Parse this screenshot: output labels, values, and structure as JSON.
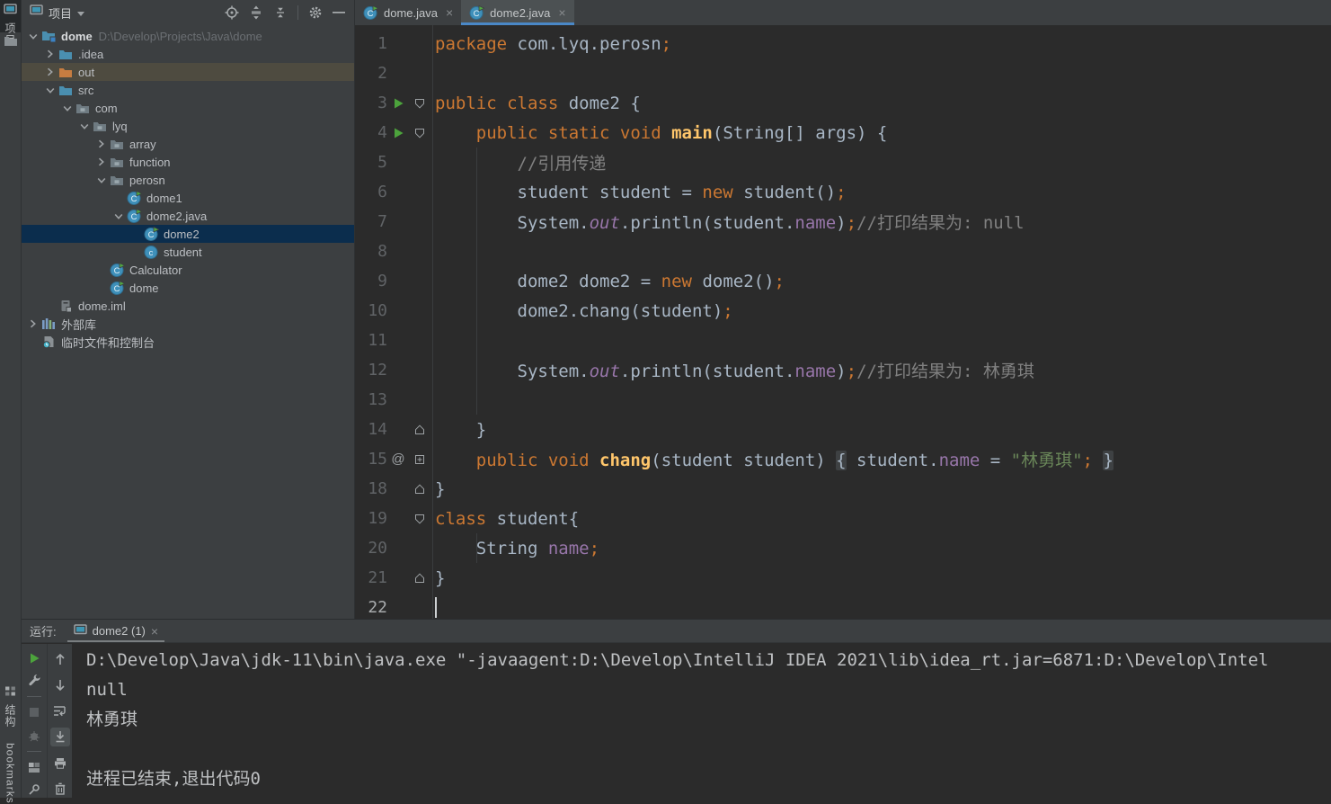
{
  "stripe": {
    "project_tab": "项目",
    "structure_tab": "结构",
    "bookmarks_tab": "bookmarks"
  },
  "project": {
    "title": "项目",
    "header_icons": [
      "locate",
      "expand-all",
      "collapse-all",
      "divider",
      "settings",
      "hide"
    ],
    "tree": [
      {
        "label": "dome",
        "path": "D:\\Develop\\Projects\\Java\\dome",
        "level": 0,
        "chevron": "down",
        "icon": "folder-root",
        "bold": true
      },
      {
        "label": ".idea",
        "level": 1,
        "chevron": "right",
        "icon": "folder"
      },
      {
        "label": "out",
        "level": 1,
        "chevron": "right",
        "icon": "folder-out",
        "state": "hover"
      },
      {
        "label": "src",
        "level": 1,
        "chevron": "down",
        "icon": "folder"
      },
      {
        "label": "com",
        "level": 2,
        "chevron": "down",
        "icon": "package"
      },
      {
        "label": "lyq",
        "level": 3,
        "chevron": "down",
        "icon": "package"
      },
      {
        "label": "array",
        "level": 4,
        "chevron": "right",
        "icon": "package"
      },
      {
        "label": "function",
        "level": 4,
        "chevron": "right",
        "icon": "package"
      },
      {
        "label": "perosn",
        "level": 4,
        "chevron": "down",
        "icon": "package"
      },
      {
        "label": "dome1",
        "level": 5,
        "icon": "class-run"
      },
      {
        "label": "dome2.java",
        "level": 5,
        "chevron": "down",
        "icon": "class-run"
      },
      {
        "label": "dome2",
        "level": 6,
        "icon": "class-run",
        "state": "selected"
      },
      {
        "label": "student",
        "level": 6,
        "icon": "class"
      },
      {
        "label": "Calculator",
        "level": 4,
        "icon": "class-run"
      },
      {
        "label": "dome",
        "level": 4,
        "icon": "class-run"
      },
      {
        "label": "dome.iml",
        "level": 1,
        "icon": "module"
      },
      {
        "label": "外部库",
        "level": 0,
        "chevron": "right",
        "icon": "libraries"
      },
      {
        "label": "临时文件和控制台",
        "level": 0,
        "icon": "scratches"
      }
    ]
  },
  "editor": {
    "tabs": [
      {
        "label": "dome.java",
        "active": false
      },
      {
        "label": "dome2.java",
        "active": true
      }
    ],
    "lines": [
      {
        "no": "1",
        "segs": [
          [
            "package",
            "kw"
          ],
          [
            " com.lyq.perosn",
            "pl"
          ],
          [
            ";",
            "semi"
          ]
        ]
      },
      {
        "no": "2",
        "segs": []
      },
      {
        "no": "3",
        "run": true,
        "fold": "open",
        "segs": [
          [
            "public class ",
            "kw"
          ],
          [
            "dome2 {",
            "pl"
          ]
        ]
      },
      {
        "no": "4",
        "run": true,
        "fold": "open",
        "segs": [
          [
            "    ",
            "pl"
          ],
          [
            "public static void ",
            "kw"
          ],
          [
            "main",
            "def"
          ],
          [
            "(String[] args) {",
            "pl"
          ]
        ]
      },
      {
        "no": "5",
        "segs": [
          [
            "        ",
            "pl"
          ],
          [
            "//引用传递",
            "cmt"
          ]
        ]
      },
      {
        "no": "6",
        "segs": [
          [
            "        student student = ",
            "pl"
          ],
          [
            "new",
            "kw"
          ],
          [
            " student()",
            "pl"
          ],
          [
            ";",
            "semi"
          ]
        ]
      },
      {
        "no": "7",
        "segs": [
          [
            "        System.",
            "pl"
          ],
          [
            "out",
            "fieldi"
          ],
          [
            ".println(student.",
            "pl"
          ],
          [
            "name",
            "field"
          ],
          [
            ")",
            "pl"
          ],
          [
            ";",
            "semi"
          ],
          [
            "//打印结果为: null",
            "cmt"
          ]
        ]
      },
      {
        "no": "8",
        "segs": []
      },
      {
        "no": "9",
        "segs": [
          [
            "        dome2 dome2 = ",
            "pl"
          ],
          [
            "new",
            "kw"
          ],
          [
            " dome2()",
            "pl"
          ],
          [
            ";",
            "semi"
          ]
        ]
      },
      {
        "no": "10",
        "segs": [
          [
            "        dome2.chang(student)",
            "pl"
          ],
          [
            ";",
            "semi"
          ]
        ]
      },
      {
        "no": "11",
        "segs": []
      },
      {
        "no": "12",
        "segs": [
          [
            "        System.",
            "pl"
          ],
          [
            "out",
            "fieldi"
          ],
          [
            ".println(student.",
            "pl"
          ],
          [
            "name",
            "field"
          ],
          [
            ")",
            "pl"
          ],
          [
            ";",
            "semi"
          ],
          [
            "//打印结果为: 林勇琪",
            "cmt"
          ]
        ]
      },
      {
        "no": "13",
        "segs": []
      },
      {
        "no": "14",
        "fold": "end",
        "segs": [
          [
            "    }",
            "pl"
          ]
        ]
      },
      {
        "no": "15",
        "ann": "@",
        "fold": "plus",
        "segs": [
          [
            "    ",
            "pl"
          ],
          [
            "public void ",
            "kw"
          ],
          [
            "chang",
            "def"
          ],
          [
            "(student student) ",
            "pl"
          ],
          [
            "{",
            "foldb"
          ],
          [
            " student.",
            "pl"
          ],
          [
            "name",
            "field"
          ],
          [
            " = ",
            "pl"
          ],
          [
            "\"林勇琪\"",
            "str"
          ],
          [
            ";",
            "semi"
          ],
          [
            " ",
            "pl"
          ],
          [
            "}",
            "foldb"
          ]
        ]
      },
      {
        "no": "18",
        "fold": "end",
        "segs": [
          [
            "}",
            "pl"
          ]
        ]
      },
      {
        "no": "19",
        "fold": "open",
        "segs": [
          [
            "class",
            "kw"
          ],
          [
            " student{",
            "pl"
          ]
        ]
      },
      {
        "no": "20",
        "segs": [
          [
            "    String ",
            "pl"
          ],
          [
            "name",
            "field"
          ],
          [
            ";",
            "semi"
          ]
        ]
      },
      {
        "no": "21",
        "fold": "end",
        "segs": [
          [
            "}",
            "pl"
          ]
        ]
      },
      {
        "no": "22",
        "cur": true,
        "caret": true,
        "segs": []
      }
    ]
  },
  "run": {
    "label": "运行:",
    "tab": "dome2 (1)",
    "toolbar_left": [
      "rerun",
      "settings-wrench",
      "divider",
      "stop",
      "force-stop",
      "divider",
      "restore-layout",
      "pin"
    ],
    "toolbar_right": [
      "up",
      "down",
      "soft-wrap",
      "scroll-to-end",
      "print",
      "clear"
    ],
    "console": [
      "D:\\Develop\\Java\\jdk-11\\bin\\java.exe \"-javaagent:D:\\Develop\\IntelliJ IDEA 2021\\lib\\idea_rt.jar=6871:D:\\Develop\\Intel",
      "null",
      "林勇琪",
      "",
      "进程已结束,退出代码0"
    ]
  },
  "colors": {
    "accent_blue": "#4a88c7",
    "selection_blue": "#0b2d4d",
    "keyword_orange": "#cc7832",
    "string_green": "#6a8759",
    "field_purple": "#9876aa",
    "run_green": "#4ca33c"
  }
}
